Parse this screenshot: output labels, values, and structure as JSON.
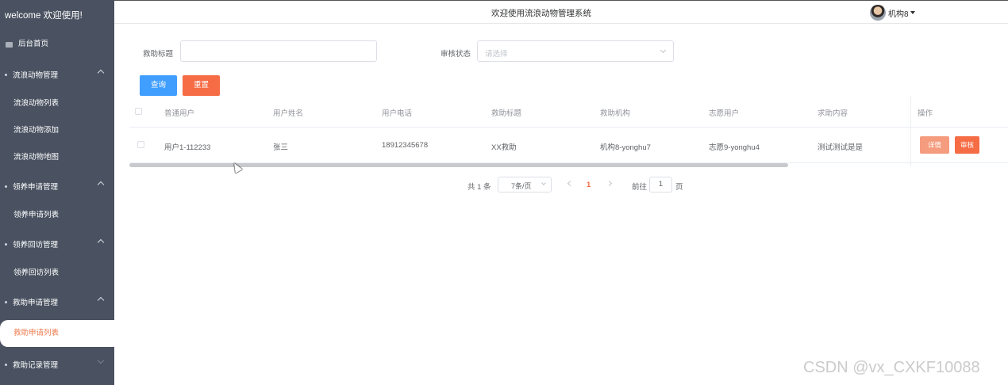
{
  "sidebar": {
    "brand": "welcome 欢迎使用!",
    "home": "后台首页",
    "groups": [
      {
        "label": "流浪动物管理",
        "items": [
          "流浪动物列表",
          "流浪动物添加",
          "流浪动物地图"
        ]
      },
      {
        "label": "领养申请管理",
        "items": [
          "领养申请列表"
        ]
      },
      {
        "label": "领养回访管理",
        "items": [
          "领养回访列表"
        ]
      },
      {
        "label": "救助申请管理",
        "items": [
          "救助申请列表"
        ]
      },
      {
        "label": "救助记录管理",
        "items": []
      }
    ],
    "active_item": "救助申请列表"
  },
  "header": {
    "title": "欢迎使用流浪动物管理系统",
    "user": "机构8"
  },
  "search": {
    "title_label": "救助标题",
    "title_value": "",
    "status_label": "审核状态",
    "status_placeholder": "请选择",
    "query_button": "查询",
    "reset_button": "重置"
  },
  "table": {
    "columns": [
      "普通用户",
      "用户姓名",
      "用户电话",
      "救助标题",
      "救助机构",
      "志愿用户",
      "求助内容",
      "操作"
    ],
    "rows": [
      [
        "用户1-112233",
        "张三",
        "18912345678",
        "XX救助",
        "机构8-yonghu7",
        "志愿9-yonghu4",
        "测试测试是是"
      ]
    ],
    "actions": {
      "detail": "详情",
      "audit": "审核"
    }
  },
  "pagination": {
    "total": "共 1 条",
    "page_size": "7条/页",
    "current_page": "1",
    "goto_label": "前往",
    "goto_value": "1",
    "page_suffix": "页"
  },
  "watermark": "CSDN @vx_CXKF10088"
}
